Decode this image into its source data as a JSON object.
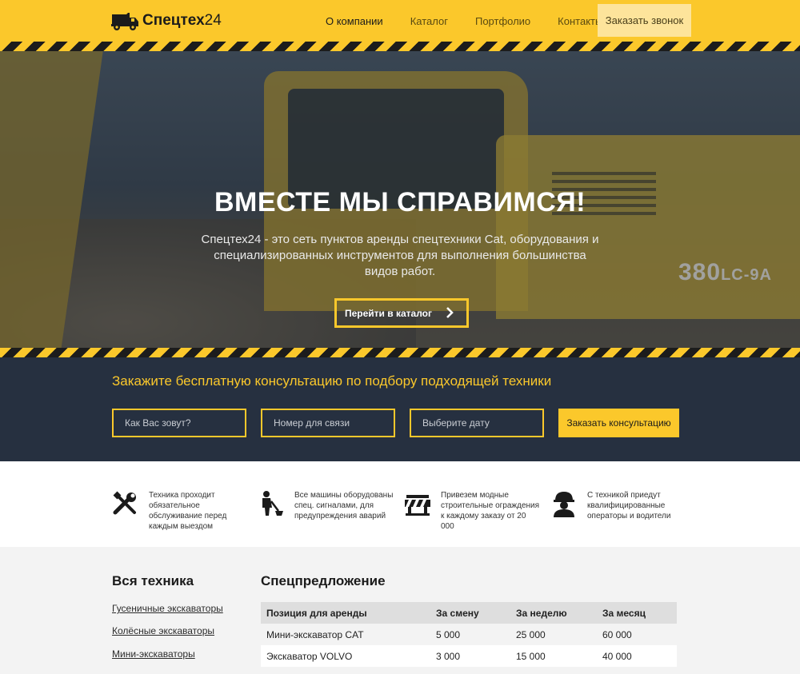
{
  "header": {
    "logo_bold": "Спецтех",
    "logo_num": "24",
    "nav": [
      "О компании",
      "Каталог",
      "Портфолио",
      "Контакты"
    ],
    "cta": "Заказать звонок"
  },
  "hero": {
    "title": "ВМЕСТЕ МЫ СПРАВИМСЯ!",
    "subtitle": "Спецтех24 - это сеть пунктов аренды спецтехники Cat, оборудования и специализированных инструментов для выполнения большинства видов работ.",
    "button": "Перейти в каталог",
    "model_main": "380",
    "model_suffix": "LC-9A"
  },
  "consult": {
    "title": "Закажите бесплатную консультацию по подбору подходящей техники",
    "name_placeholder": "Как Вас зовут?",
    "phone_placeholder": "Номер для связи",
    "date_placeholder": "Выберите дату",
    "submit": "Заказать консультацию"
  },
  "features": [
    {
      "icon": "tools-icon",
      "text": "Техника проходит обязательное обслуживание перед каждым выездом"
    },
    {
      "icon": "worker-icon",
      "text": "Все машины оборудованы спец. сигналами, для предупреждения аварий"
    },
    {
      "icon": "barrier-icon",
      "text": "Привезем модные строительные ограждения к каждому заказу от 20 000"
    },
    {
      "icon": "helmet-icon",
      "text": "С техникой приедут квалифицированные операторы и водители"
    }
  ],
  "catalog": {
    "title": "Вся техника",
    "links": [
      "Гусеничные экскаваторы",
      "Колёсные экскаваторы",
      "Мини-экскаваторы"
    ]
  },
  "offers": {
    "title": "Спецпредложение",
    "columns": [
      "Позиция для аренды",
      "За смену",
      "За неделю",
      "За месяц"
    ],
    "rows": [
      [
        "Мини-экскаватор CAT",
        "5 000",
        "25 000",
        "60 000"
      ],
      [
        "Экскаватор VOLVO",
        "3 000",
        "15 000",
        "40 000"
      ]
    ]
  },
  "colors": {
    "accent": "#fbc82b",
    "dark": "#263040"
  }
}
